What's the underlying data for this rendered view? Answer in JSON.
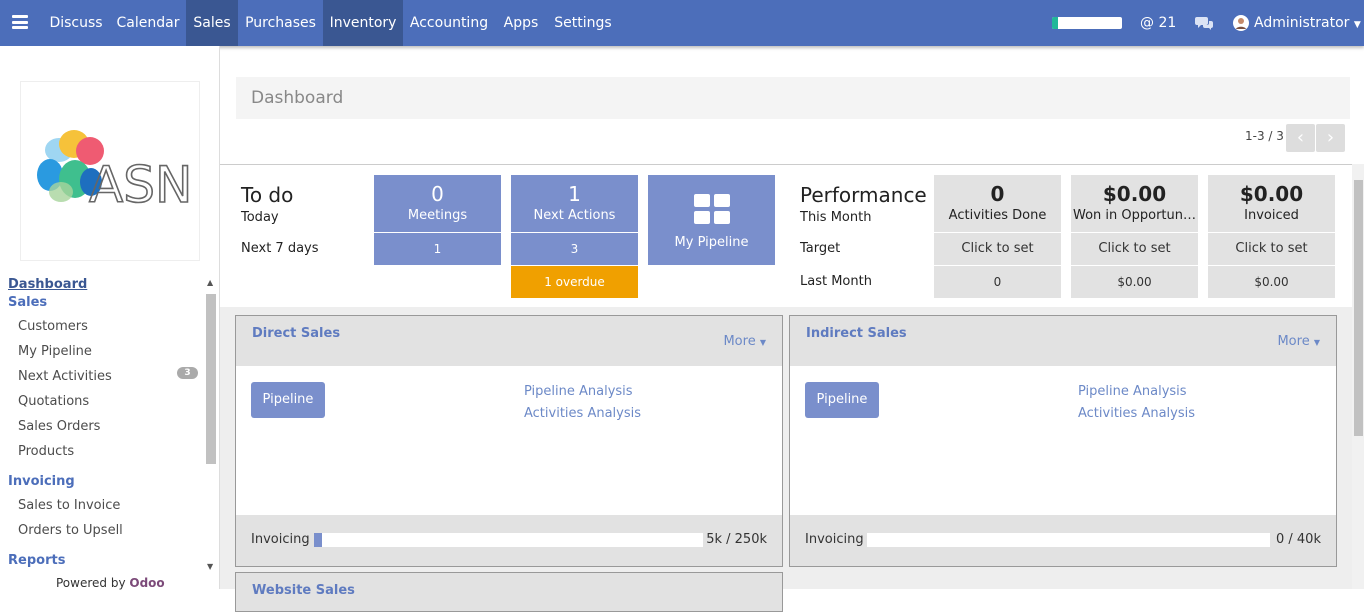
{
  "topbar": {
    "menus": [
      "Discuss",
      "Calendar",
      "Sales",
      "Purchases",
      "Inventory",
      "Accounting",
      "Apps",
      "Settings"
    ],
    "active_menus": [
      "Sales",
      "Inventory"
    ],
    "messages_count": "@ 21",
    "user": "Administrator",
    "progress": 0.08,
    "colors": {
      "bar": "#4c6eba",
      "active": "#3a5792"
    }
  },
  "sidebar": {
    "logo_text": "ASN",
    "dashboard": "Dashboard",
    "sales_header": "Sales",
    "sales_items": [
      "Customers",
      "My Pipeline",
      "Next Activities",
      "Quotations",
      "Sales Orders",
      "Products"
    ],
    "next_activities_badge": "3",
    "invoicing_header": "Invoicing",
    "invoicing_items": [
      "Sales to Invoice",
      "Orders to Upsell"
    ],
    "reports_header": "Reports",
    "powered_prefix": "Powered by",
    "powered_brand": "Odoo"
  },
  "breadcrumb": {
    "title": "Dashboard"
  },
  "pager": {
    "text": "1-3 / 3",
    "prev": "‹",
    "next": "›"
  },
  "todo": {
    "title": "To do",
    "today_label": "Today",
    "next7_label": "Next 7 days",
    "meetings": {
      "count": "0",
      "label": "Meetings",
      "next7": "1"
    },
    "next_actions": {
      "count": "1",
      "label": "Next Actions",
      "next7": "3",
      "overdue": "1 overdue"
    },
    "pipeline_label": "My Pipeline"
  },
  "performance": {
    "title": "Performance",
    "this_month_label": "This Month",
    "target_label": "Target",
    "last_month_label": "Last Month",
    "activities": {
      "value": "0",
      "label": "Activities Done",
      "target": "Click to set",
      "last": "0"
    },
    "won": {
      "value": "$0.00",
      "label": "Won in Opportun…",
      "target": "Click to set",
      "last": "$0.00"
    },
    "invoiced": {
      "value": "$0.00",
      "label": "Invoiced",
      "target": "Click to set",
      "last": "$0.00"
    }
  },
  "cards": [
    {
      "title": "Direct Sales",
      "more": "More",
      "pipeline": "Pipeline",
      "link1": "Pipeline Analysis",
      "link2": "Activities Analysis",
      "foot_label": "Invoicing",
      "foot_value": "5k / 250k",
      "progress": 0.02
    },
    {
      "title": "Indirect Sales",
      "more": "More",
      "pipeline": "Pipeline",
      "link1": "Pipeline Analysis",
      "link2": "Activities Analysis",
      "foot_label": "Invoicing",
      "foot_value": "0 / 40k",
      "progress": 0.0
    }
  ],
  "card3_title": "Website Sales"
}
